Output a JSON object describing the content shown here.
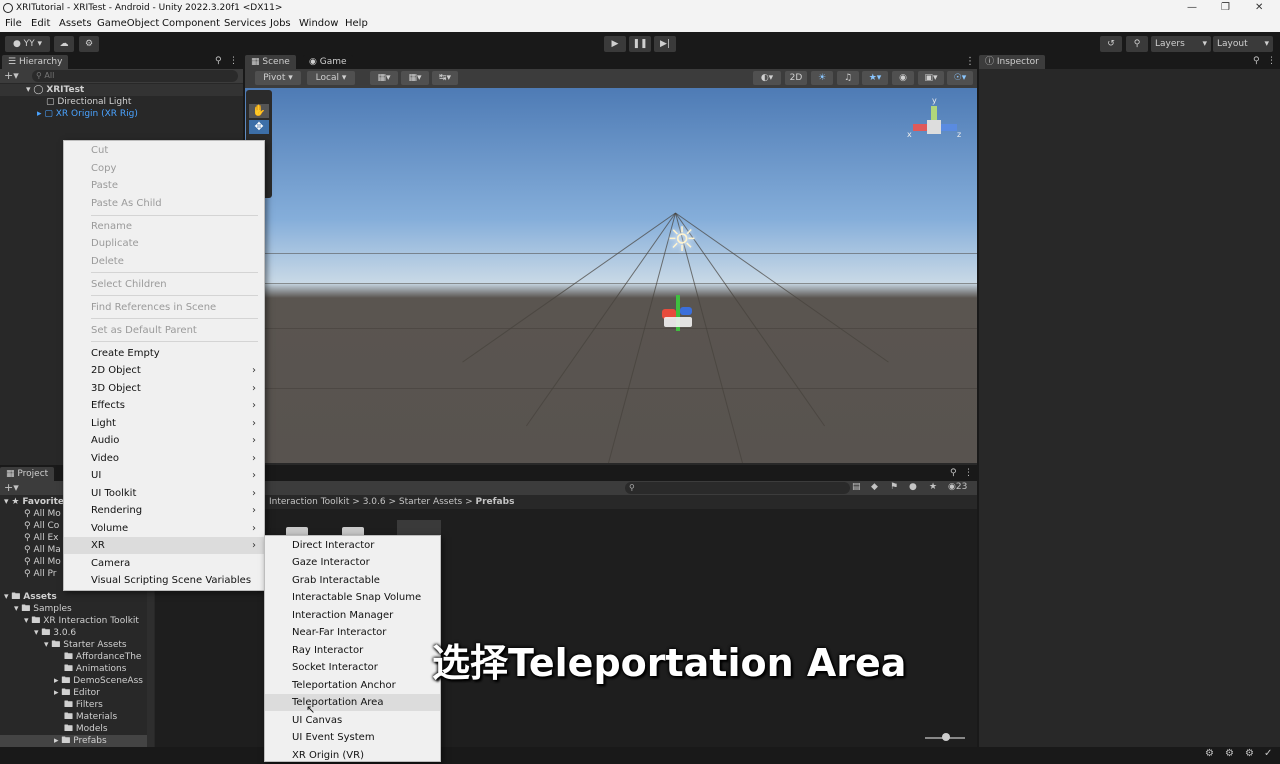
{
  "window": {
    "title": "XRITutorial - XRITest - Android - Unity 2022.3.20f1 <DX11>"
  },
  "menubar": [
    "File",
    "Edit",
    "Assets",
    "GameObject",
    "Component",
    "Services",
    "Jobs",
    "Window",
    "Help"
  ],
  "toolbar": {
    "account": "YY",
    "layers": "Layers",
    "layout": "Layout"
  },
  "hierarchy": {
    "tab": "Hierarchy",
    "search_placeholder": "All",
    "scene": "XRITest",
    "items": [
      "Directional Light",
      "XR Origin (XR Rig)"
    ]
  },
  "scene_view": {
    "tabs": [
      "Scene",
      "Game"
    ],
    "pivot": "Pivot",
    "local": "Local",
    "mode_2d": "2D",
    "gizmo_axes": [
      "y",
      "x",
      "z"
    ]
  },
  "inspector": {
    "tab": "Inspector"
  },
  "project": {
    "tab": "Project",
    "breadcrumb": [
      "Interaction Toolkit",
      "3.0.6",
      "Starter Assets",
      "Prefabs"
    ],
    "hidden_count": "23",
    "favorites": {
      "label": "Favorites",
      "items": [
        "All Mo",
        "All Co",
        "All Ex",
        "All Ma",
        "All Mo",
        "All Pr"
      ]
    },
    "tree": [
      "Assets",
      "Samples",
      "XR Interaction Toolkit",
      "3.0.6",
      "Starter Assets",
      "AffordanceThe",
      "Animations",
      "DemoSceneAss",
      "Editor",
      "Filters",
      "Materials",
      "Models",
      "Prefabs"
    ]
  },
  "context_menu": {
    "group1": [
      "Cut",
      "Copy",
      "Paste",
      "Paste As Child"
    ],
    "group2": [
      "Rename",
      "Duplicate",
      "Delete"
    ],
    "group3": [
      "Select Children"
    ],
    "group4": [
      "Find References in Scene"
    ],
    "group5": [
      "Set as Default Parent"
    ],
    "group6": [
      "Create Empty",
      "2D Object",
      "3D Object",
      "Effects",
      "Light",
      "Audio",
      "Video",
      "UI",
      "UI Toolkit",
      "Rendering",
      "Volume",
      "XR",
      "Camera",
      "Visual Scripting Scene Variables"
    ]
  },
  "xr_submenu": [
    "Direct Interactor",
    "Gaze Interactor",
    "Grab Interactable",
    "Interactable Snap Volume",
    "Interaction Manager",
    "Near-Far Interactor",
    "Ray Interactor",
    "Socket Interactor",
    "Teleportation Anchor",
    "Teleportation Area",
    "UI Canvas",
    "UI Event System",
    "XR Origin (VR)"
  ],
  "subtitle": "选择Teleportation Area",
  "colors": {
    "selected_text": "#4aa3ff",
    "editor_bg": "#282828",
    "menu_bg": "#f0f0f0"
  }
}
